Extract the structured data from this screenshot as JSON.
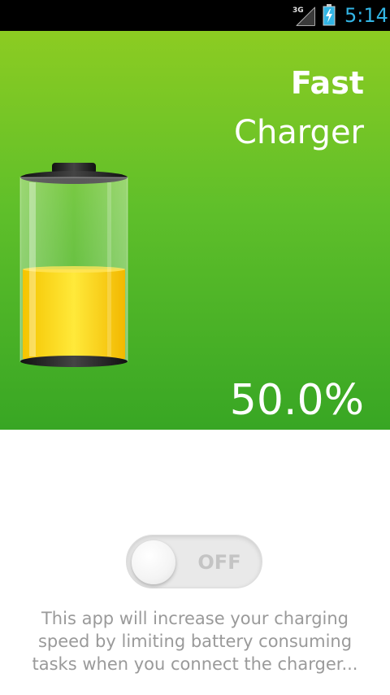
{
  "status_bar": {
    "network_label": "3G",
    "time": "5:14",
    "icons": [
      "signal-icon",
      "battery-charging-icon"
    ],
    "accent_color": "#33b5e5"
  },
  "app": {
    "title_line1": "Fast",
    "title_line2": "Charger",
    "battery_percent_text": "50.0%",
    "battery_level": 0.5,
    "colors": {
      "hero_top": "#8ccc22",
      "hero_bottom": "#38a624",
      "battery_fill": "#ffd21a"
    }
  },
  "toggle": {
    "label": "OFF",
    "state": "off"
  },
  "description": "This app will increase your charging speed by limiting battery consuming tasks when you connect the charger..."
}
